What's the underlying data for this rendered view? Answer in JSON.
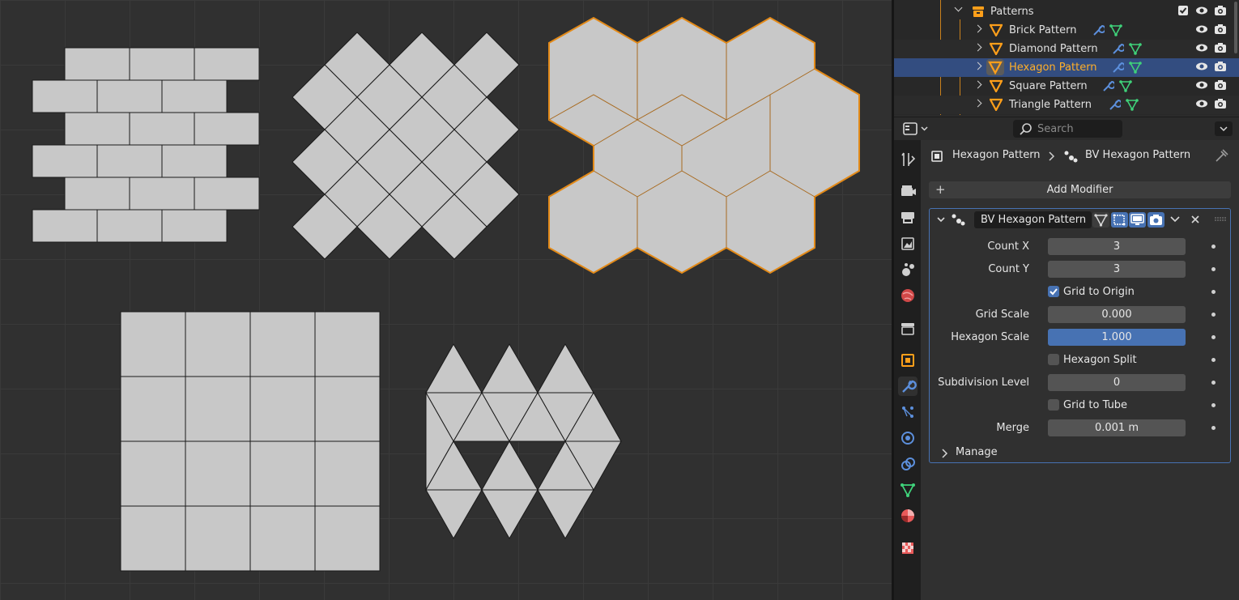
{
  "outliner": {
    "rows": [
      {
        "label": "Patterns",
        "type": "collection"
      },
      {
        "label": "Brick Pattern",
        "type": "mesh"
      },
      {
        "label": "Diamond Pattern",
        "type": "mesh"
      },
      {
        "label": "Hexagon Pattern",
        "type": "mesh",
        "selected": true
      },
      {
        "label": "Square Pattern",
        "type": "mesh"
      },
      {
        "label": "Triangle Pattern",
        "type": "mesh"
      }
    ]
  },
  "properties": {
    "search_placeholder": "Search",
    "breadcrumb": {
      "object": "Hexagon Pattern",
      "modifier": "BV Hexagon Pattern"
    },
    "add_modifier_label": "Add Modifier",
    "modifier": {
      "name": "BV Hexagon Pattern",
      "fields": {
        "count_x": {
          "label": "Count X",
          "value": "3"
        },
        "count_y": {
          "label": "Count Y",
          "value": "3"
        },
        "grid_to_origin": {
          "label": "Grid to Origin",
          "checked": true
        },
        "grid_scale": {
          "label": "Grid Scale",
          "value": "0.000"
        },
        "hexagon_scale": {
          "label": "Hexagon Scale",
          "value": "1.000"
        },
        "hexagon_split": {
          "label": "Hexagon Split",
          "checked": false
        },
        "subdivision_level": {
          "label": "Subdivision Level",
          "value": "0"
        },
        "grid_to_tube": {
          "label": "Grid to Tube",
          "checked": false
        },
        "merge": {
          "label": "Merge",
          "value": "0.001 m"
        }
      },
      "manage_label": "Manage"
    }
  },
  "colors": {
    "accent": "#4772b3",
    "selected_text": "#ffaf29",
    "mesh_icon": "#ff9f1a",
    "vertex_group_icon": "#3fd27a",
    "wrench_icon": "#5c8fdc",
    "selection_outline": "#e38a18",
    "mesh_fill": "#c8c8c8"
  },
  "icons": [
    "collection-icon",
    "mesh-icon",
    "wrench-icon",
    "vertex-icon",
    "eye-icon",
    "camera-icon",
    "checkbox-icon",
    "search-icon",
    "pin-icon",
    "close-icon"
  ]
}
